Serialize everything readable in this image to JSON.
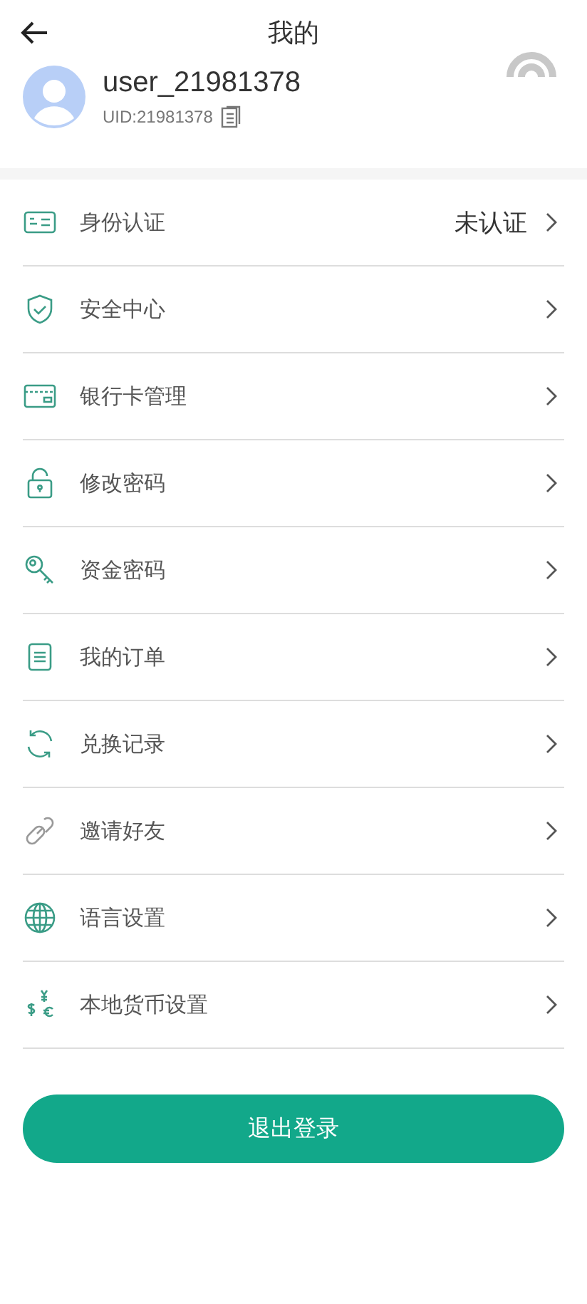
{
  "header": {
    "title": "我的"
  },
  "profile": {
    "username": "user_21981378",
    "uid": "UID:21981378"
  },
  "menu": [
    {
      "kind": "id-card",
      "label": "身份认证",
      "status": "未认证"
    },
    {
      "kind": "shield",
      "label": "安全中心"
    },
    {
      "kind": "bank-card",
      "label": "银行卡管理"
    },
    {
      "kind": "lock",
      "label": "修改密码"
    },
    {
      "kind": "key",
      "label": "资金密码"
    },
    {
      "kind": "orders",
      "label": "我的订单"
    },
    {
      "kind": "exchange",
      "label": "兑换记录"
    },
    {
      "kind": "link",
      "label": "邀请好友"
    },
    {
      "kind": "globe",
      "label": "语言设置"
    },
    {
      "kind": "currency",
      "label": "本地货币设置"
    }
  ],
  "logout_button": "退出登录"
}
